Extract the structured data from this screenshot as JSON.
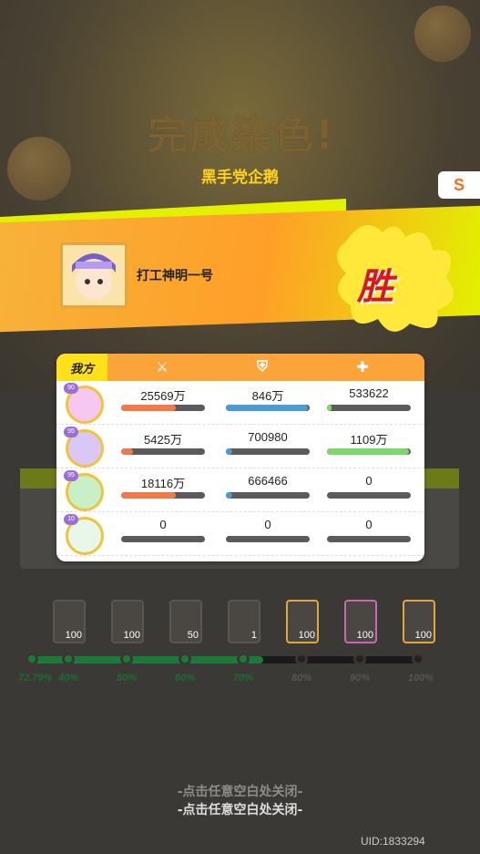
{
  "header": {
    "title": "完成染色!",
    "team_name": "黑手党企鹅",
    "side_tab_label": "S"
  },
  "player": {
    "name": "打工神明一号",
    "result": "胜"
  },
  "stats": {
    "side_label": "我方",
    "columns": [
      "attack-icon",
      "defense-icon",
      "heal-icon"
    ],
    "rows": [
      {
        "level": "90",
        "damage": "25569万",
        "damage_fill": 0.65,
        "defense": "846万",
        "defense_fill": 0.98,
        "heal": "533622",
        "heal_fill": 0.05
      },
      {
        "level": "95",
        "damage": "5425万",
        "damage_fill": 0.14,
        "defense": "700980",
        "defense_fill": 0.08,
        "heal": "1109万",
        "heal_fill": 0.98
      },
      {
        "level": "95",
        "damage": "18116万",
        "damage_fill": 0.65,
        "defense": "666466",
        "defense_fill": 0.08,
        "heal": "0",
        "heal_fill": 0.0
      },
      {
        "level": "10",
        "damage": "0",
        "damage_fill": 0.0,
        "defense": "0",
        "defense_fill": 0.0,
        "heal": "0",
        "heal_fill": 0.0
      }
    ]
  },
  "rewards": {
    "items": [
      {
        "count": "100"
      },
      {
        "count": "100"
      },
      {
        "count": "50"
      },
      {
        "count": "1"
      },
      {
        "count": "100"
      },
      {
        "count": "100"
      },
      {
        "count": "100"
      }
    ],
    "current_progress": "72.79%",
    "milestones": [
      "40%",
      "50%",
      "60%",
      "70%",
      "80%",
      "90%",
      "100%"
    ],
    "progress_fraction": 0.7279
  },
  "footer": {
    "close_hint": "-点击任意空白处关闭-",
    "uid": "UID:1833294"
  },
  "colors": {
    "accent_orange": "#fba43a",
    "banner_yellow": "#e3f000",
    "win_red": "#d6191e",
    "attack_bar": "#f27a4a",
    "defense_bar": "#4a9ad6",
    "heal_bar": "#7ad96a",
    "progress_green": "#1b7a3a"
  }
}
